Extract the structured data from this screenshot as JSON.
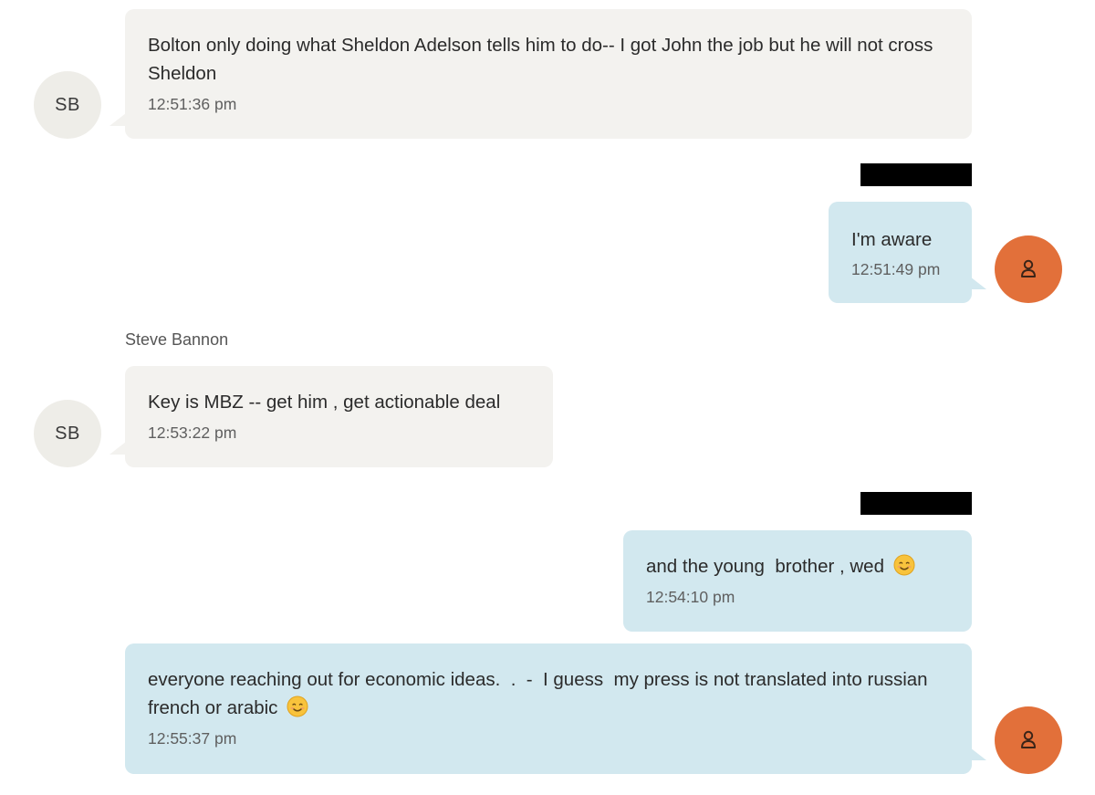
{
  "colors": {
    "incoming_bubble": "#f3f2ef",
    "outgoing_bubble": "#d2e8ef",
    "user_avatar": "#e2703a",
    "sender_avatar": "#eeede8",
    "redaction": "#000000"
  },
  "sender": {
    "name": "Steve Bannon",
    "initials": "SB"
  },
  "user": {
    "avatar_icon": "person-icon"
  },
  "messages": [
    {
      "direction": "incoming",
      "text": "Bolton only doing what Sheldon Adelson tells him to do-- I got John the job but he will not cross Sheldon",
      "time": "12:51:36 pm"
    },
    {
      "direction": "outgoing",
      "text": "I'm aware",
      "time": "12:51:49 pm"
    },
    {
      "direction": "incoming",
      "text": "Key is MBZ -- get him , get actionable deal",
      "time": "12:53:22 pm"
    },
    {
      "direction": "outgoing",
      "text": "and the young  brother , wed",
      "emoji": "smiling-face-emoji",
      "time": "12:54:10 pm"
    },
    {
      "direction": "outgoing",
      "text": "everyone reaching out for economic ideas.  .  -  I guess  my press is not translated into russian french or arabic",
      "emoji": "smiling-face-emoji",
      "time": "12:55:37 pm"
    }
  ]
}
